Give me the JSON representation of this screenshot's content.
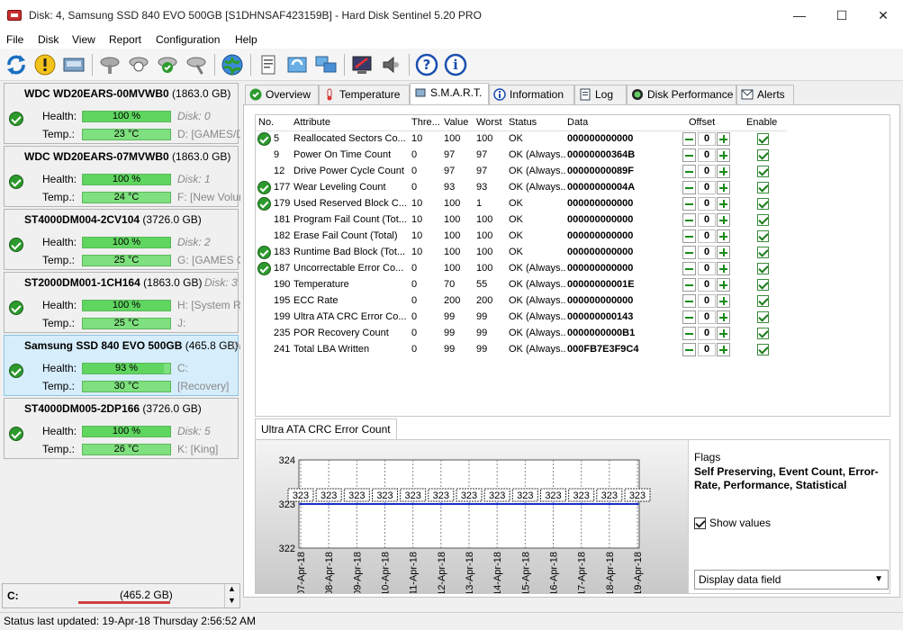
{
  "window": {
    "title": "Disk: 4, Samsung SSD 840 EVO 500GB [S1DHNSAF423159B]  -  Hard Disk Sentinel 5.20 PRO"
  },
  "menu": [
    "File",
    "Disk",
    "View",
    "Report",
    "Configuration",
    "Help"
  ],
  "labels": {
    "health": "Health:",
    "temp": "Temp.:"
  },
  "disks": [
    {
      "name": "WDC WD20EARS-00MVWB0",
      "size": "(1863.0 GB)",
      "health": "100 %",
      "health_pct": 100,
      "temp": "23 °C",
      "disk_id": "Disk: 0",
      "drive": "D: [GAMES/D"
    },
    {
      "name": "WDC WD20EARS-07MVWB0",
      "size": "(1863.0 GB)",
      "health": "100 %",
      "health_pct": 100,
      "temp": "24 °C",
      "disk_id": "Disk: 1",
      "drive": "F: [New Volum"
    },
    {
      "name": "ST4000DM004-2CV104",
      "size": "(3726.0 GB)",
      "health": "100 %",
      "health_pct": 100,
      "temp": "25 °C",
      "disk_id": "Disk: 2",
      "drive": "G: [GAMES OI"
    },
    {
      "name": "ST2000DM001-1CH164",
      "size": "(1863.0 GB)",
      "health": "100 %",
      "health_pct": 100,
      "temp": "25 °C",
      "disk_id": "Disk: 3",
      "drive": "H: [System Re",
      "drive2": "J:"
    },
    {
      "name": "Samsung SSD 840 EVO 500GB",
      "size": "(465.8 GB)",
      "health": "93 %",
      "health_pct": 93,
      "temp": "30 °C",
      "disk_id": "Di",
      "drive": "C:",
      "drive2": "[Recovery]"
    },
    {
      "name": "ST4000DM005-2DP166",
      "size": "(3726.0 GB)",
      "health": "100 %",
      "health_pct": 100,
      "temp": "26 °C",
      "disk_id": "Disk: 5",
      "drive": "K: [King]"
    }
  ],
  "partition": {
    "drive": "C:",
    "size": "(465.2 GB)"
  },
  "status": "Status last updated: 19-Apr-18 Thursday 2:56:52 AM",
  "tabs": [
    "Overview",
    "Temperature",
    "S.M.A.R.T.",
    "Information",
    "Log",
    "Disk Performance",
    "Alerts"
  ],
  "smart": {
    "headers": [
      "No.",
      "Attribute",
      "Thre...",
      "Value",
      "Worst",
      "Status",
      "Data",
      "Offset",
      "Enable"
    ],
    "rows": [
      {
        "ok": true,
        "no": "5",
        "attr": "Reallocated Sectors Co...",
        "thr": "10",
        "val": "100",
        "worst": "100",
        "status": "OK",
        "data": "000000000000",
        "offset": "0"
      },
      {
        "ok": false,
        "no": "9",
        "attr": "Power On Time Count",
        "thr": "0",
        "val": "97",
        "worst": "97",
        "status": "OK (Always...",
        "data": "00000000364B",
        "offset": "0"
      },
      {
        "ok": false,
        "no": "12",
        "attr": "Drive Power Cycle Count",
        "thr": "0",
        "val": "97",
        "worst": "97",
        "status": "OK (Always...",
        "data": "00000000089F",
        "offset": "0"
      },
      {
        "ok": true,
        "no": "177",
        "attr": "Wear Leveling Count",
        "thr": "0",
        "val": "93",
        "worst": "93",
        "status": "OK (Always...",
        "data": "00000000004A",
        "offset": "0"
      },
      {
        "ok": true,
        "no": "179",
        "attr": "Used Reserved Block C...",
        "thr": "10",
        "val": "100",
        "worst": "1",
        "status": "OK",
        "data": "000000000000",
        "offset": "0"
      },
      {
        "ok": false,
        "no": "181",
        "attr": "Program Fail Count (Tot...",
        "thr": "10",
        "val": "100",
        "worst": "100",
        "status": "OK",
        "data": "000000000000",
        "offset": "0"
      },
      {
        "ok": false,
        "no": "182",
        "attr": "Erase Fail Count (Total)",
        "thr": "10",
        "val": "100",
        "worst": "100",
        "status": "OK",
        "data": "000000000000",
        "offset": "0"
      },
      {
        "ok": true,
        "no": "183",
        "attr": "Runtime Bad Block (Tot...",
        "thr": "10",
        "val": "100",
        "worst": "100",
        "status": "OK",
        "data": "000000000000",
        "offset": "0"
      },
      {
        "ok": true,
        "no": "187",
        "attr": "Uncorrectable Error Co...",
        "thr": "0",
        "val": "100",
        "worst": "100",
        "status": "OK (Always...",
        "data": "000000000000",
        "offset": "0"
      },
      {
        "ok": false,
        "no": "190",
        "attr": "Temperature",
        "thr": "0",
        "val": "70",
        "worst": "55",
        "status": "OK (Always...",
        "data": "00000000001E",
        "offset": "0"
      },
      {
        "ok": false,
        "no": "195",
        "attr": "ECC Rate",
        "thr": "0",
        "val": "200",
        "worst": "200",
        "status": "OK (Always...",
        "data": "000000000000",
        "offset": "0"
      },
      {
        "ok": false,
        "no": "199",
        "attr": "Ultra ATA CRC Error Co...",
        "thr": "0",
        "val": "99",
        "worst": "99",
        "status": "OK (Always...",
        "data": "000000000143",
        "offset": "0"
      },
      {
        "ok": false,
        "no": "235",
        "attr": "POR Recovery Count",
        "thr": "0",
        "val": "99",
        "worst": "99",
        "status": "OK (Always...",
        "data": "0000000000B1",
        "offset": "0"
      },
      {
        "ok": false,
        "no": "241",
        "attr": "Total LBA Written",
        "thr": "0",
        "val": "99",
        "worst": "99",
        "status": "OK (Always...",
        "data": "000FB7E3F9C4",
        "offset": "0"
      }
    ]
  },
  "chart_tab": "Ultra ATA CRC Error Count",
  "chart_data": {
    "type": "line",
    "x": [
      "07-Apr-18",
      "08-Apr-18",
      "09-Apr-18",
      "10-Apr-18",
      "11-Apr-18",
      "12-Apr-18",
      "13-Apr-18",
      "14-Apr-18",
      "15-Apr-18",
      "16-Apr-18",
      "17-Apr-18",
      "18-Apr-18",
      "19-Apr-18"
    ],
    "series": [
      {
        "values": [
          323,
          323,
          323,
          323,
          323,
          323,
          323,
          323,
          323,
          323,
          323,
          323,
          323
        ]
      }
    ],
    "yticks": [
      "324",
      "323",
      "322"
    ],
    "ylim": [
      322,
      324
    ],
    "grid": true,
    "color": "#1a2fc8"
  },
  "flags": {
    "title": "Flags",
    "text": "Self Preserving, Event Count, Error-Rate, Performance, Statistical"
  },
  "show_values": "Show values",
  "display_select": "Display data field",
  "colors": {
    "ok": "#2d9a2d",
    "health_bar": "#7ee07e",
    "selected": "#d6edfb"
  }
}
